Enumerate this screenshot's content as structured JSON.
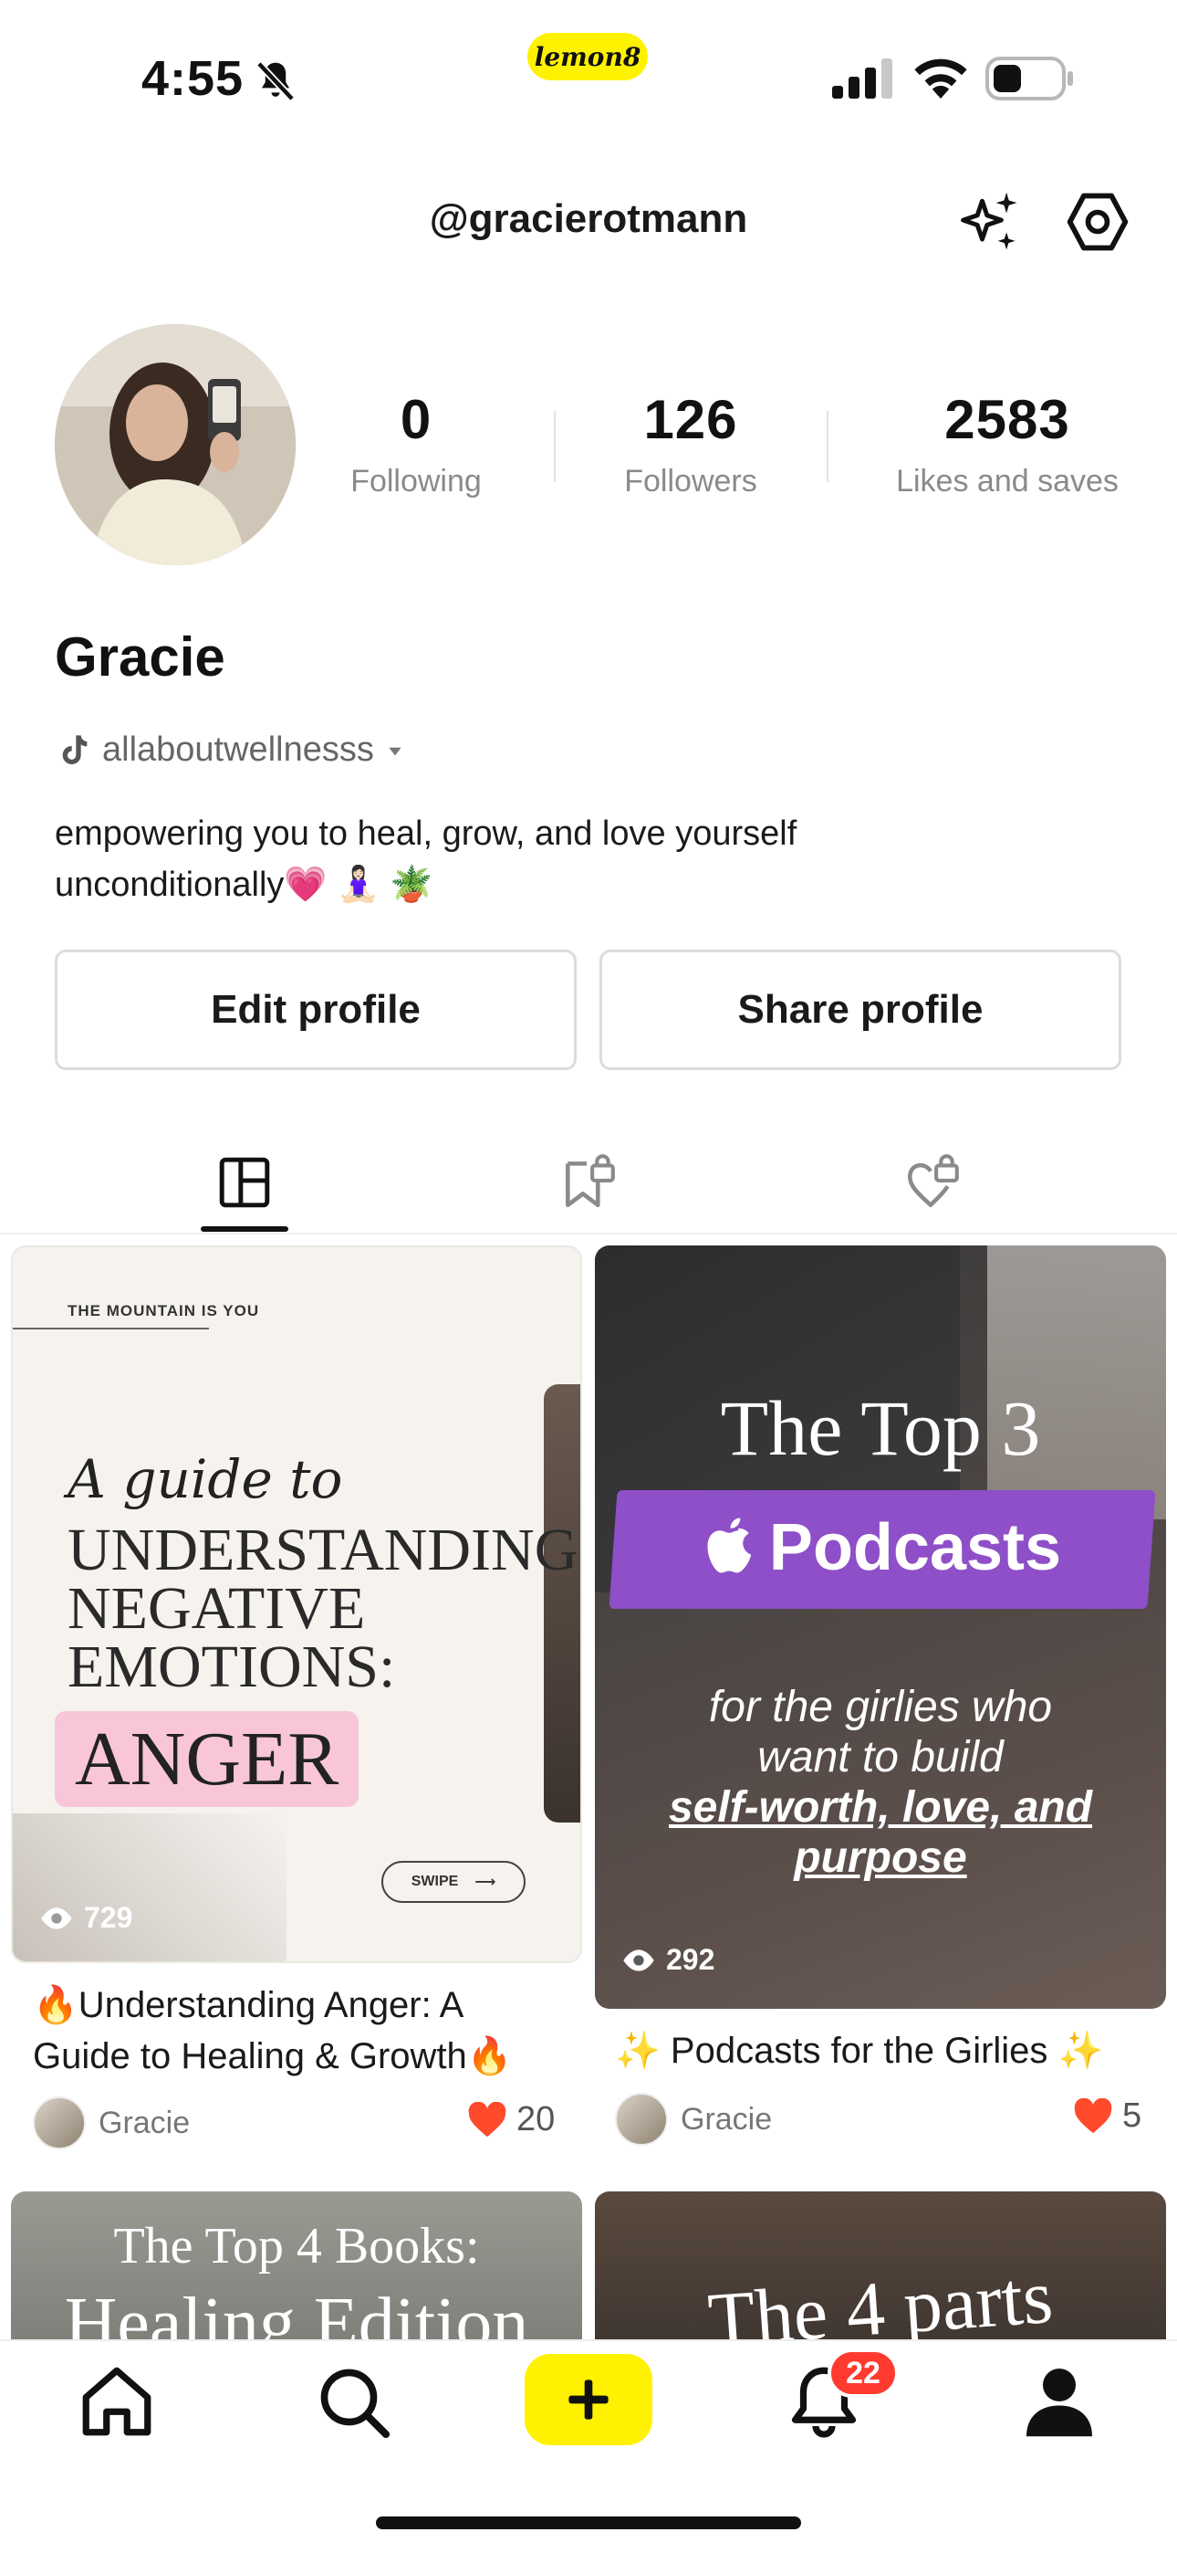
{
  "status_bar": {
    "time": "4:55",
    "brand": "lemon8"
  },
  "header": {
    "handle": "@gracierotmann"
  },
  "profile": {
    "name": "Gracie",
    "stats": [
      {
        "value": "0",
        "label": "Following"
      },
      {
        "value": "126",
        "label": "Followers"
      },
      {
        "value": "2583",
        "label": "Likes and saves"
      }
    ],
    "linked_account": "allaboutwellnesss",
    "bio_line1": "empowering you to heal, grow, and love yourself",
    "bio_line2": "unconditionally💗 🧘🏻‍♀️ 🪴"
  },
  "actions": {
    "edit_label": "Edit profile",
    "share_label": "Share profile"
  },
  "tabs": [
    "posts-grid-icon",
    "saved-locked-icon",
    "liked-locked-icon"
  ],
  "posts": [
    {
      "cover_tag": "THE MOUNTAIN IS YOU",
      "cover_script": "A guide to",
      "cover_line1": "UNDERSTANDING",
      "cover_line2": "NEGATIVE",
      "cover_line3": "EMOTIONS:",
      "cover_highlight": "ANGER",
      "cover_swipe": "SWIPE",
      "views": "729",
      "title_line1": "🔥Understanding Anger: A",
      "title_line2": "Guide to Healing & Growth🔥",
      "author": "Gracie",
      "likes": "20"
    },
    {
      "cover_title": "The Top 3",
      "cover_badge": "Podcasts",
      "cover_line1": "for the girlies who",
      "cover_line2": "want to build",
      "cover_line3": "self-worth, love, and",
      "cover_line4": "purpose",
      "views": "292",
      "title": "✨ Podcasts for the Girlies ✨",
      "author": "Gracie",
      "likes": "5"
    }
  ],
  "more_posts": [
    {
      "cover_line1": "The Top 4 Books:",
      "cover_line2": "Healing Edition"
    },
    {
      "cover_line1": "The 4 parts"
    }
  ],
  "nav": {
    "notification_count": "22"
  },
  "colors": {
    "brand_yellow": "#fff200",
    "heart_red": "#ff4b2b",
    "badge_red": "#ff3b30",
    "podcast_purple": "#8e4fc8"
  }
}
